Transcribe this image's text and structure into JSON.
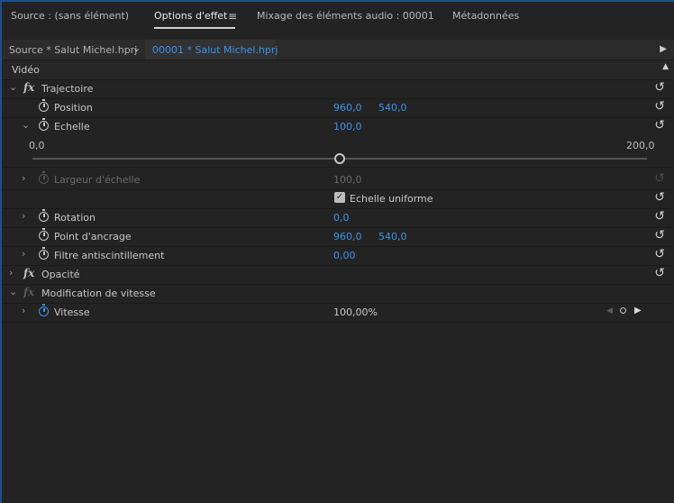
{
  "tabs": {
    "source": "Source : (sans élément)",
    "effect_options": "Options d'effet",
    "menu_glyph": "≡",
    "audio_mixer": "Mixage des éléments audio : 00001",
    "metadata": "Métadonnées"
  },
  "sequence_bar": {
    "source_label": "Source * Salut Michel.hprj",
    "active_label": "00001 * Salut Michel.hprj"
  },
  "panel": {
    "video_header": "Vidéo",
    "motion": {
      "label": "Trajectoire",
      "position": {
        "label": "Position",
        "x": "960,0",
        "y": "540,0"
      },
      "scale": {
        "label": "Echelle",
        "value": "100,0",
        "slider_min": "0,0",
        "slider_max": "200,0",
        "slider_value": 100
      },
      "scale_width": {
        "label": "Largeur d'échelle",
        "value": "100,0"
      },
      "uniform_scale": {
        "label": "Echelle uniforme",
        "checked": true
      },
      "rotation": {
        "label": "Rotation",
        "value": "0,0"
      },
      "anchor_point": {
        "label": "Point d'ancrage",
        "x": "960,0",
        "y": "540,0"
      },
      "anti_flicker": {
        "label": "Filtre antiscintillement",
        "value": "0,00"
      }
    },
    "opacity": {
      "label": "Opacité"
    },
    "time_remap": {
      "label": "Modification de vitesse",
      "speed": {
        "label": "Vitesse",
        "value": "100,00%"
      }
    }
  },
  "icons": {
    "fx": "fx",
    "reset": "↺",
    "chevron_right": "›",
    "chevron_down": "⌄"
  },
  "colors": {
    "accent_blue": "#3d93e8",
    "background": "#232323"
  }
}
